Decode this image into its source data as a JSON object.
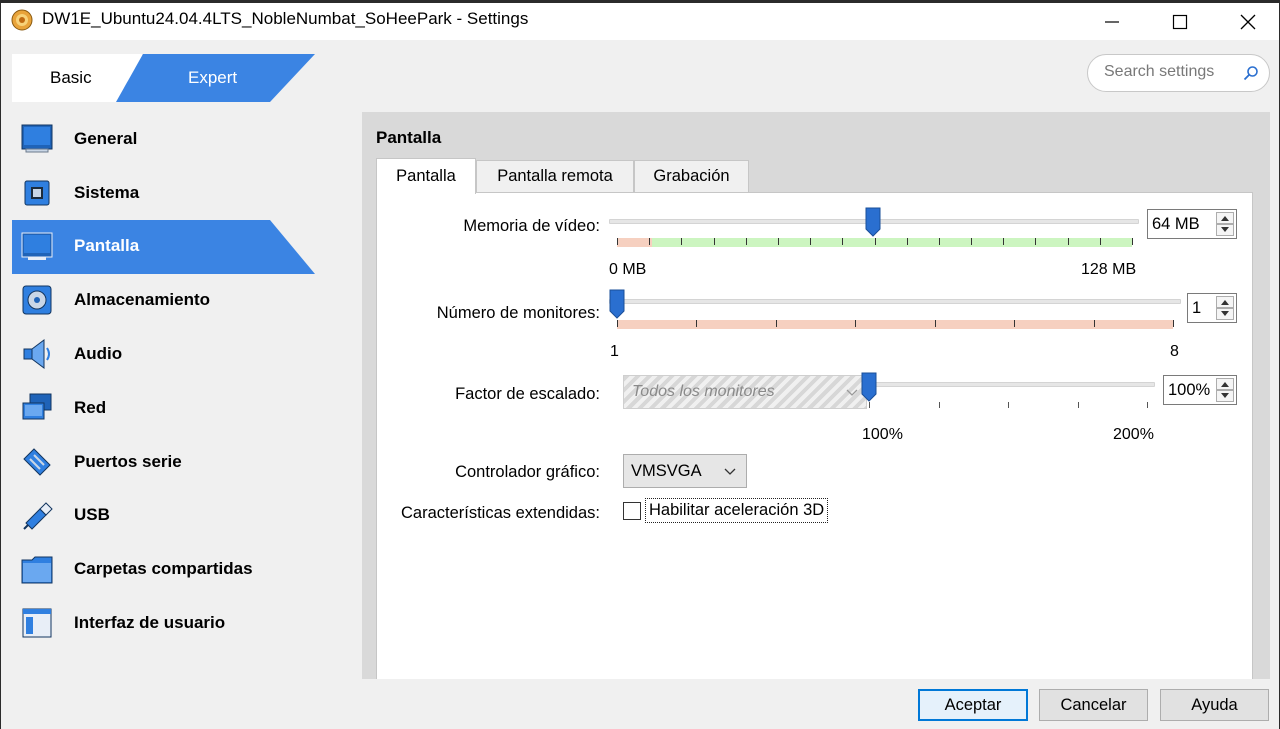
{
  "window": {
    "title": "DW1E_Ubuntu24.04.4LTS_NobleNumbat_SoHeePark - Settings"
  },
  "mode_switch": {
    "basic_label": "Basic",
    "expert_label": "Expert",
    "active": "Expert"
  },
  "search": {
    "placeholder": "Search settings"
  },
  "sidebar": {
    "items": [
      {
        "label": "General",
        "icon": "monitor-general-icon"
      },
      {
        "label": "Sistema",
        "icon": "chip-icon"
      },
      {
        "label": "Pantalla",
        "icon": "display-icon",
        "active": true
      },
      {
        "label": "Almacenamiento",
        "icon": "disk-icon"
      },
      {
        "label": "Audio",
        "icon": "speaker-icon"
      },
      {
        "label": "Red",
        "icon": "network-icon"
      },
      {
        "label": "Puertos serie",
        "icon": "serial-port-icon"
      },
      {
        "label": "USB",
        "icon": "usb-icon"
      },
      {
        "label": "Carpetas compartidas",
        "icon": "folder-icon"
      },
      {
        "label": "Interfaz de usuario",
        "icon": "window-icon"
      }
    ]
  },
  "panel": {
    "title": "Pantalla",
    "tabs": [
      {
        "label": "Pantalla",
        "active": true
      },
      {
        "label": "Pantalla remota"
      },
      {
        "label": "Grabación"
      }
    ],
    "video_memory": {
      "label": "Memoria de vídeo:",
      "value": "64 MB",
      "value_mb": 64,
      "min_label": "0 MB",
      "max_label": "128 MB"
    },
    "monitors": {
      "label": "Número de monitores:",
      "value": "1",
      "min_label": "1",
      "max_label": "8"
    },
    "scale": {
      "label": "Factor de escalado:",
      "combo_value": "Todos los monitores",
      "value": "100%",
      "min_label": "100%",
      "max_label": "200%"
    },
    "graphics_controller": {
      "label": "Controlador gráfico:",
      "value": "VMSVGA"
    },
    "extended": {
      "label": "Características extendidas:",
      "checkbox_label": "Habilitar aceleración 3D",
      "checked": false
    }
  },
  "buttons": {
    "accept": "Aceptar",
    "cancel": "Cancelar",
    "help": "Ayuda"
  },
  "colors": {
    "accent": "#3b84e3",
    "zone_green": "#ccf5c0",
    "zone_red": "#f6d0c0"
  }
}
